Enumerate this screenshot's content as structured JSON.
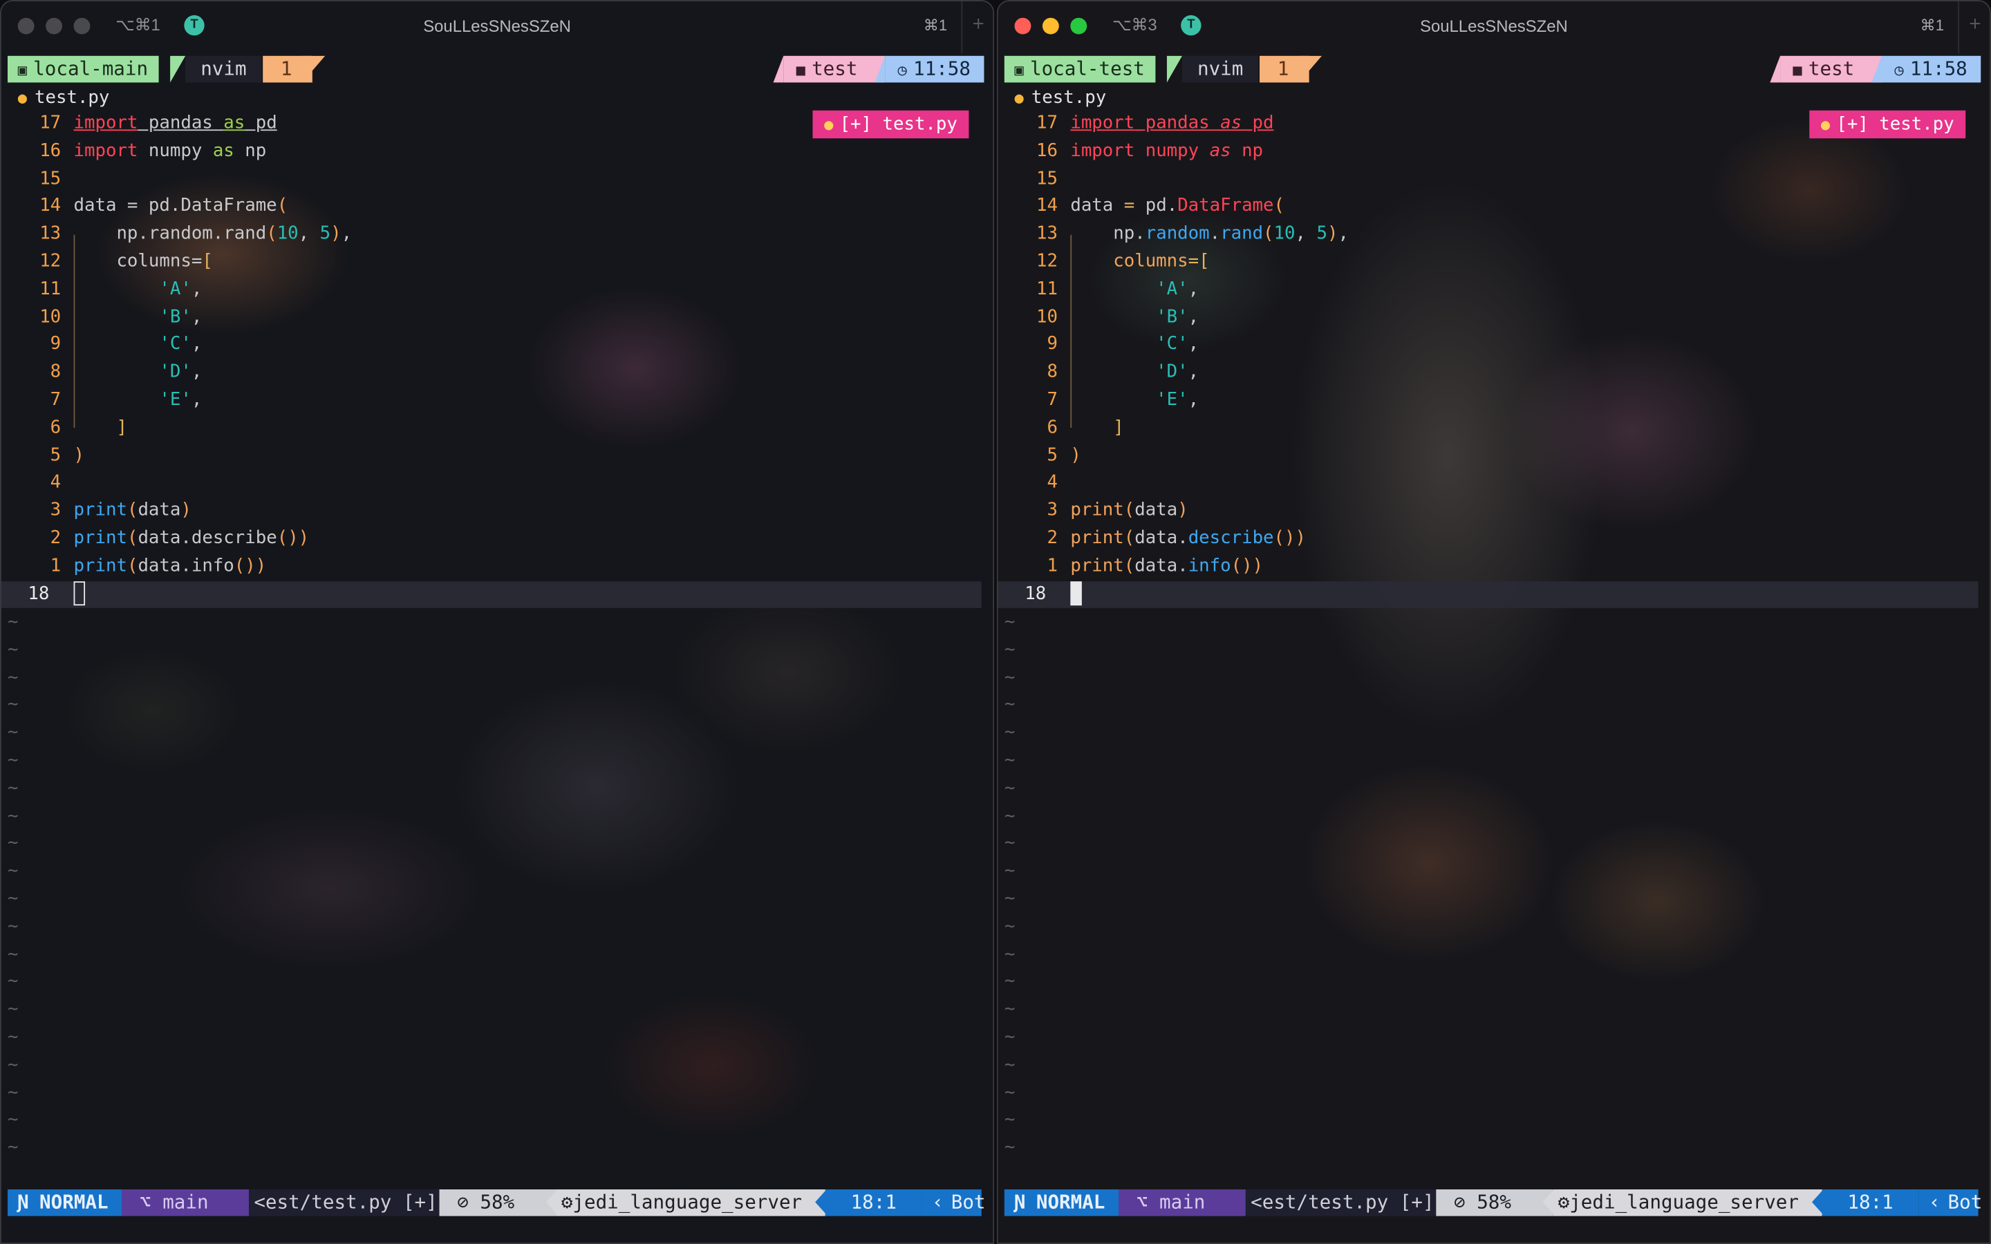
{
  "panes": [
    {
      "titlebar": {
        "shortcut": "⌥⌘1",
        "tmux_icon": "T",
        "title": "SouLLesSNesSZeN",
        "cmd_shortcut": "⌘1",
        "new_tab": "+"
      },
      "tmux": {
        "session": "local-main",
        "program": "nvim",
        "window": "1",
        "folder": "test",
        "time": "11:58"
      },
      "winbar": {
        "filename": "test.py"
      },
      "badge": "[+] test.py",
      "cursor_line_number": "18",
      "status": {
        "mode": "NORMAL",
        "branch": "main",
        "file": "<est/test.py [+]",
        "encoding": "58%",
        "lsp": "jedi_language_server",
        "position": "18:1",
        "scroll": "Bot"
      }
    },
    {
      "titlebar": {
        "shortcut": "⌥⌘3",
        "tmux_icon": "T",
        "title": "SouLLesSNesSZeN",
        "cmd_shortcut": "⌘1",
        "new_tab": "+"
      },
      "tmux": {
        "session": "local-test",
        "program": "nvim",
        "window": "1",
        "folder": "test",
        "time": "11:58"
      },
      "winbar": {
        "filename": "test.py"
      },
      "badge": "[+] test.py",
      "cursor_line_number": "18",
      "status": {
        "mode": "NORMAL",
        "branch": "main",
        "file": "<est/test.py [+]",
        "encoding": "58%",
        "lsp": "jedi_language_server",
        "position": "18:1",
        "scroll": "Bot"
      }
    }
  ],
  "code": {
    "line_numbers": [
      "17",
      "16",
      "15",
      "14",
      "13",
      "12",
      "11",
      "10",
      "9",
      "8",
      "7",
      "6",
      "5",
      "4",
      "3",
      "2",
      "1"
    ],
    "lines": [
      "import pandas as pd",
      "import numpy as np",
      "",
      "data = pd.DataFrame(",
      "    np.random.rand(10, 5),",
      "    columns=[",
      "        'A',",
      "        'B',",
      "        'C',",
      "        'D',",
      "        'E',",
      "    ]",
      ")",
      "",
      "print(data)",
      "print(data.describe())",
      "print(data.info())"
    ]
  },
  "tilde": "~",
  "colors": {
    "keyword": "#ff4457",
    "function": "#3fa8f2",
    "number": "#27c0b6",
    "paren": "#f3a35a",
    "line_number": "#f2a04a",
    "mode_bg": "#1773c9",
    "branch_bg": "#5b3c9a",
    "badge_bg": "#e8348a",
    "session_bg": "#9be09f",
    "window_bg": "#f7b27a",
    "folder_bg": "#f6b5d0",
    "time_bg": "#a3c8f6"
  },
  "icons": [
    "terminal-icon",
    "folder-icon",
    "clock-icon",
    "python-icon",
    "github-icon",
    "lock-icon",
    "gear-icon",
    "neovim-icon"
  ]
}
